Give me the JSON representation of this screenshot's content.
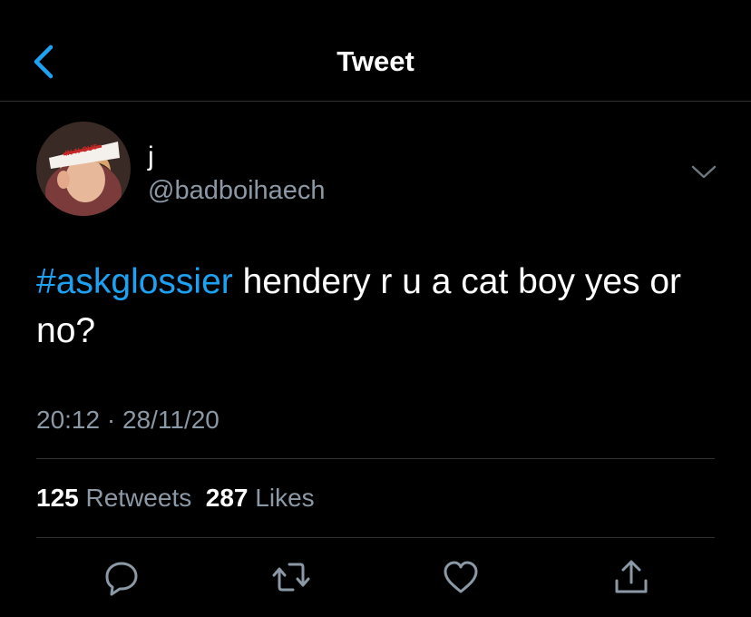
{
  "nav": {
    "title": "Tweet",
    "back_icon": "chevron-left-icon"
  },
  "author": {
    "display_name": "j",
    "handle": "@badboihaech",
    "avatar": "profile-photo-in-n-out-paper-hat",
    "avatar_hat_text": "IN-N-OUT"
  },
  "tweet": {
    "hashtag": "#askglossier",
    "text": " hendery r u a cat boy yes or no?",
    "timestamp": "20:12 · 28/11/20"
  },
  "stats": {
    "retweets_count": "125",
    "retweets_label": "Retweets",
    "likes_count": "287",
    "likes_label": "Likes"
  },
  "actions": [
    "reply-icon",
    "retweet-icon",
    "like-icon",
    "share-icon"
  ],
  "colors": {
    "background": "#000000",
    "accent": "#1da1f2",
    "secondary_text": "#8b98a5",
    "divider": "#2f3336"
  }
}
